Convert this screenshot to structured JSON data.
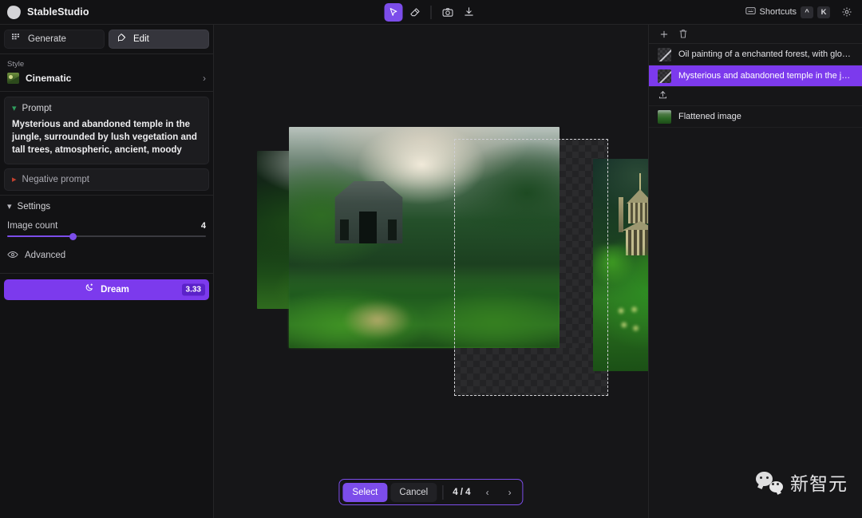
{
  "app": {
    "brand": "StableStudio"
  },
  "toolbar": {
    "tools": [
      {
        "name": "cursor-tool",
        "active": true
      },
      {
        "name": "eraser-tool",
        "active": false
      },
      {
        "name": "camera-tool",
        "active": false
      },
      {
        "name": "download-tool",
        "active": false
      }
    ],
    "shortcuts_label": "Shortcuts",
    "shortcut_keys": [
      "^",
      "K"
    ],
    "settings_icon": "gear-icon"
  },
  "left_panel": {
    "tabs": [
      {
        "label": "Generate",
        "icon": "grid-icon",
        "active": false
      },
      {
        "label": "Edit",
        "icon": "pencil-square-icon",
        "active": true
      }
    ],
    "style": {
      "label": "Style",
      "value": "Cinematic"
    },
    "prompt": {
      "header": "Prompt",
      "text": "Mysterious and abandoned temple in the jungle, surrounded by lush vegetation and tall trees, atmospheric, ancient, moody"
    },
    "negative_prompt": {
      "header": "Negative prompt"
    },
    "settings": {
      "header": "Settings",
      "image_count_label": "Image count",
      "image_count_value": "4",
      "image_count_percent": 33,
      "advanced_label": "Advanced"
    },
    "dream": {
      "label": "Dream",
      "credits": "3.33"
    }
  },
  "canvas": {
    "action_bar": {
      "select_label": "Select",
      "cancel_label": "Cancel",
      "counter": "4 / 4",
      "prev_icon": "chevron-left-icon",
      "next_icon": "chevron-right-icon"
    }
  },
  "right_panel": {
    "toolbar": {
      "add_icon": "plus-icon",
      "delete_icon": "trash-icon"
    },
    "documents": [
      {
        "label": "Oil painting of a enchanted forest, with glowing ...",
        "thumb": "checker",
        "selected": false
      },
      {
        "label": "Mysterious and abandoned temple in the jungle, ...",
        "thumb": "checker",
        "selected": true
      }
    ],
    "upload_icon": "upload-icon",
    "flattened": {
      "label": "Flattened image",
      "thumb": "photo"
    }
  },
  "watermark": {
    "text": "新智元",
    "logo": "wechat-icon"
  },
  "colors": {
    "accent": "#7c3aed",
    "accent_light": "#7c4dea",
    "panel": "#121214",
    "canvas_bg": "#161618",
    "chevron_open": "#2f9e5e",
    "chevron_closed": "#c2412f"
  }
}
